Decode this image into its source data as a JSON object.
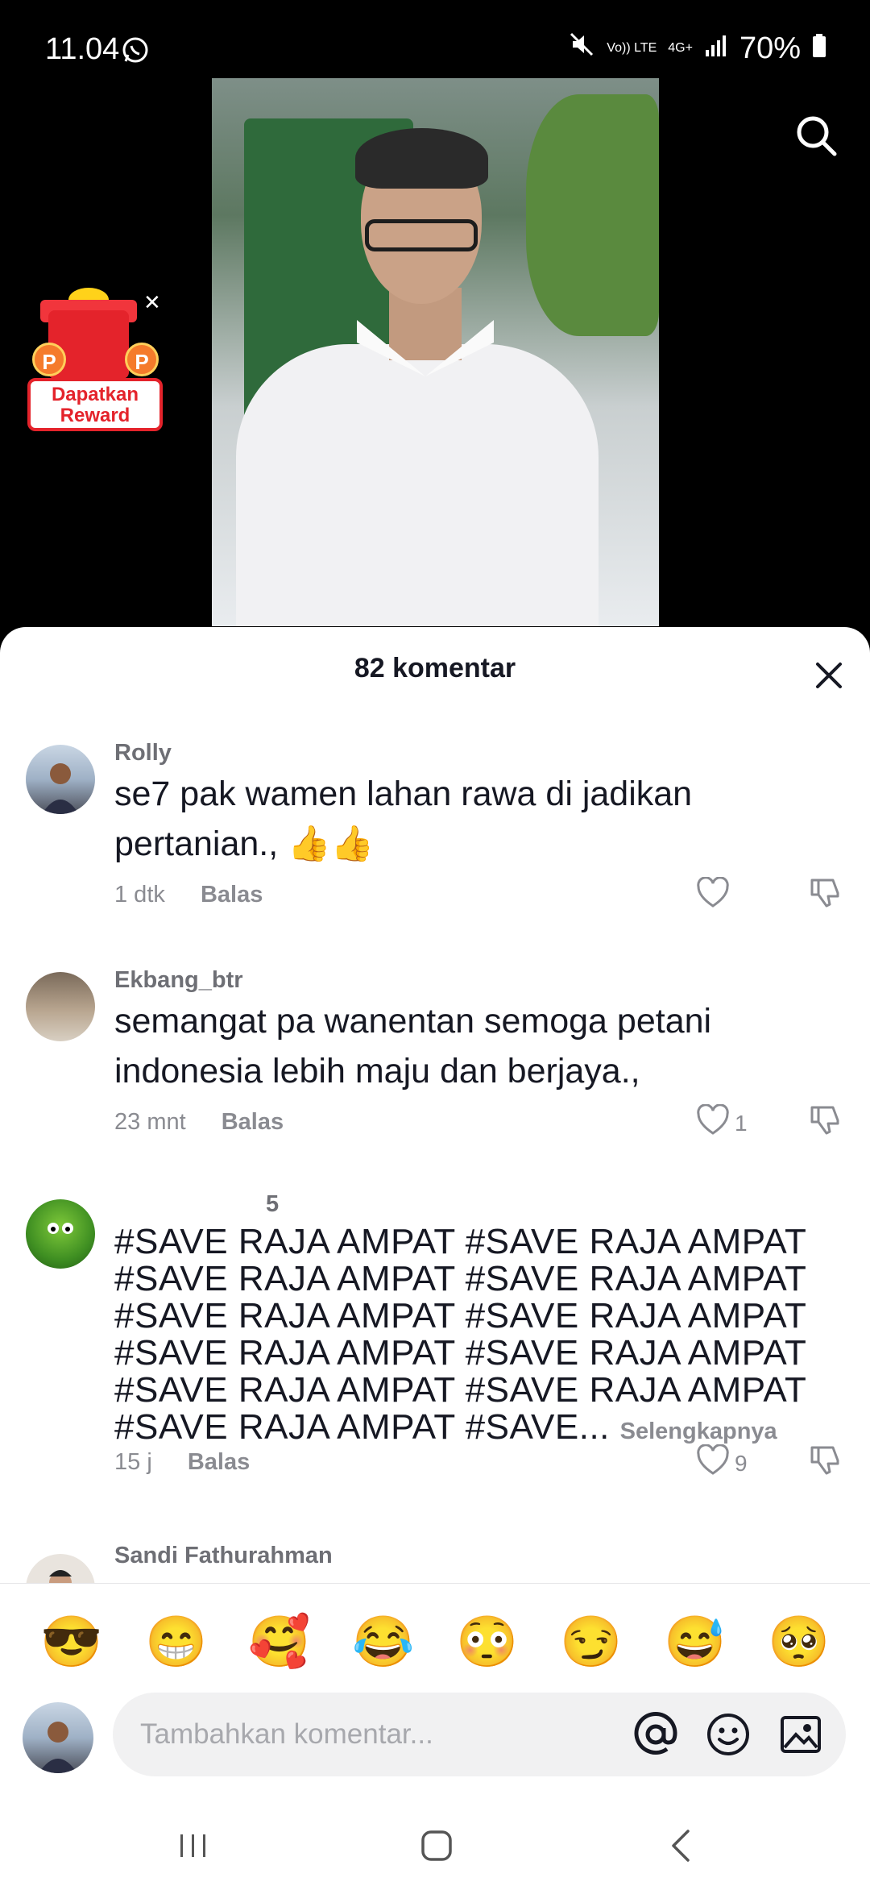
{
  "status_bar": {
    "time": "11.04",
    "volte": "Vo)) LTE",
    "network": "4G+",
    "battery": "70%",
    "icons": [
      "whatsapp-icon",
      "mute-icon",
      "volte-icon",
      "network-4g-icon",
      "signal-icon",
      "battery-icon"
    ]
  },
  "video": {
    "icons": [
      "search-icon"
    ]
  },
  "reward": {
    "label_line1": "Dapatkan",
    "label_line2": "Reward",
    "coin_letter": "P",
    "icons": [
      "gift-icon",
      "close-icon"
    ]
  },
  "sheet": {
    "title": "82 komentar",
    "comments": [
      {
        "user": "Rolly",
        "text": "se7 pak wamen lahan rawa di jadikan pertanian., 👍👍",
        "time": "1 dtk",
        "reply": "Balas",
        "likes": ""
      },
      {
        "user": "Ekbang_btr",
        "text": "semangat pa wanentan semoga petani indonesia lebih maju dan berjaya.,",
        "time": "23 mnt",
        "reply": "Balas",
        "likes": "1"
      },
      {
        "user": "5",
        "text": "#SAVE RAJA AMPAT #SAVE RAJA AMPAT #SAVE RAJA AMPAT #SAVE RAJA AMPAT #SAVE RAJA AMPAT #SAVE RAJA AMPAT #SAVE RAJA AMPAT #SAVE RAJA AMPAT #SAVE RAJA AMPAT #SAVE RAJA AMPAT #SAVE RAJA AMPAT #SAVE...",
        "more": "Selengkapnya",
        "time": "15 j",
        "reply": "Balas",
        "likes": "9"
      },
      {
        "user": "Sandi Fathurahman"
      }
    ]
  },
  "emoji_bar": [
    "😎",
    "😁",
    "🥰",
    "😂",
    "😳",
    "😏",
    "😅",
    "🥺"
  ],
  "input": {
    "placeholder": "Tambahkan komentar...",
    "icons": [
      "mention-icon",
      "emoji-icon",
      "image-icon"
    ]
  },
  "nav": {
    "icons": [
      "recents-icon",
      "home-icon",
      "back-icon"
    ]
  },
  "colors": {
    "reward_red": "#e4232b",
    "text_primary": "#161823",
    "text_secondary": "#8a8b91"
  }
}
